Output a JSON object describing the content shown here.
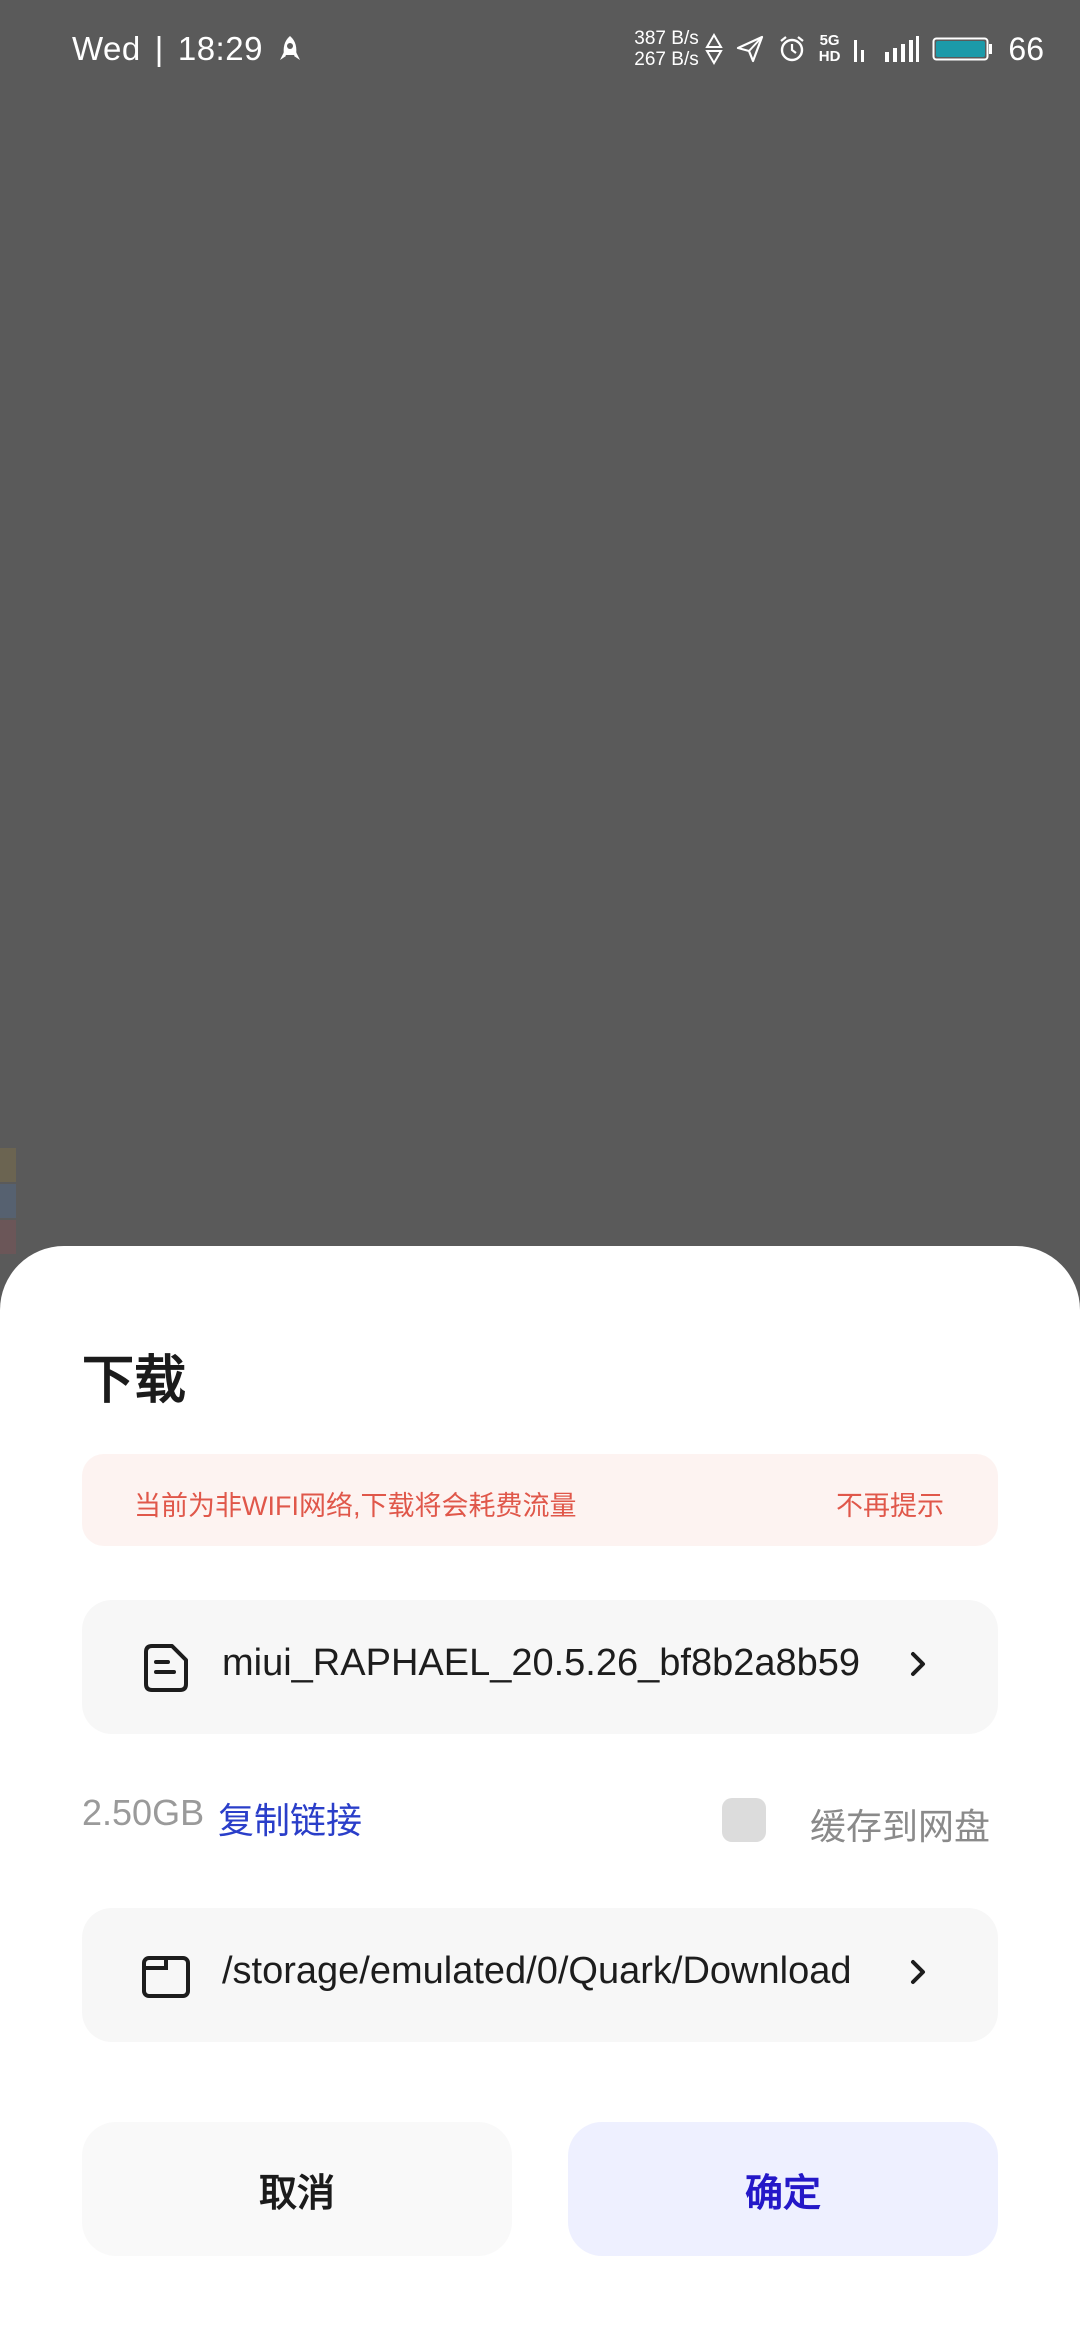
{
  "status_bar": {
    "day": "Wed",
    "separator": "|",
    "time": "18:29",
    "net_up": "387 B/s",
    "net_down": "267 B/s",
    "network_type": "5G",
    "network_sub": "HD",
    "battery": "66",
    "icons": [
      "rocket-icon",
      "arrow-up-icon",
      "arrow-down-icon",
      "send-icon",
      "alarm-icon",
      "5g-hd-icon",
      "signal-icon",
      "wifi-icon",
      "battery-icon"
    ]
  },
  "dialog": {
    "title": "下载",
    "warning": {
      "text": "当前为非WIFI网络,下载将会耗费流量",
      "dismiss_label": "不再提示"
    },
    "file": {
      "name": "miui_RAPHAEL_20.5.26_bf8b2a8b59",
      "icon": "document-icon"
    },
    "size": "2.50GB",
    "copy_link_label": "复制链接",
    "cache_to_cloud": {
      "label": "缓存到网盘",
      "checked": false
    },
    "path": {
      "value": "/storage/emulated/0/Quark/Download",
      "icon": "folder-icon"
    },
    "buttons": {
      "cancel": "取消",
      "confirm": "确定"
    }
  },
  "colors": {
    "overlay": "#5a5a5a",
    "warning_bg": "#fdf3f1",
    "warning_text": "#e0574a",
    "link": "#2a3ec9",
    "confirm_bg": "#eef0ff",
    "confirm_text": "#2418c8"
  }
}
